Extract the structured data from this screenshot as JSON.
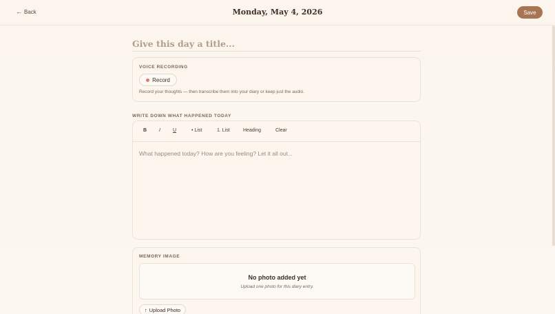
{
  "header": {
    "back_label": "Back",
    "back_icon": "arrow-left-icon",
    "date": "Monday, May 4, 2026",
    "save_label": "Save"
  },
  "title_field": {
    "placeholder": "Give this day a title...",
    "value": ""
  },
  "voice": {
    "label": "VOICE RECORDING",
    "record_label": "Record",
    "help": "Record your thoughts — then transcribe them into your diary or keep just the audio."
  },
  "editor": {
    "label": "WRITE DOWN WHAT HAPPENED TODAY",
    "toolbar": {
      "bold": "B",
      "italic": "I",
      "underline": "U",
      "bullet_list": "• List",
      "numbered_list": "1. List",
      "heading": "Heading",
      "clear": "Clear"
    },
    "placeholder": "What happened today? How are you feeling? Let it all out...",
    "value": ""
  },
  "memory": {
    "label": "MEMORY IMAGE",
    "empty_title": "No photo added yet",
    "empty_help": "Upload one photo for this diary entry.",
    "upload_label": "Upload Photo",
    "upload_icon": "arrow-up-icon"
  },
  "colors": {
    "accent": "#a87553",
    "record_dot": "#e07a72",
    "background": "#fbf5ee"
  }
}
